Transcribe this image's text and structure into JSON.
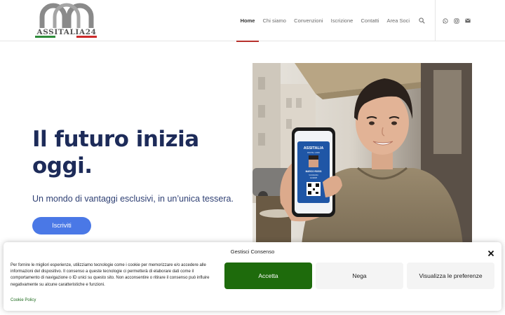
{
  "logo": {
    "text": "ASSITALIA24",
    "flag_colors": [
      "#2e8b3a",
      "#ffffff",
      "#cc2a2a"
    ]
  },
  "nav": {
    "items": [
      {
        "label": "Home",
        "active": true
      },
      {
        "label": "Chi siamo",
        "active": false
      },
      {
        "label": "Convenzioni",
        "active": false
      },
      {
        "label": "Iscrizione",
        "active": false
      },
      {
        "label": "Contatti",
        "active": false
      },
      {
        "label": "Area Soci",
        "active": false
      }
    ],
    "search_icon": "search-icon",
    "social_icons": [
      "whatsapp-icon",
      "instagram-icon",
      "mail-icon"
    ]
  },
  "hero": {
    "title": "Il futuro inizia oggi.",
    "subtitle": "Un mondo di vantaggi esclusivi, in un’unica tessera.",
    "button": "Iscriviti"
  },
  "photo": {
    "phone_card": {
      "brand": "ASSITALIA",
      "card_type": "DIGITAL CARD",
      "name": "MARCO ROSSI",
      "member_label": "SCADENZA",
      "date": "12/2025"
    }
  },
  "colors": {
    "accent": "#b7312c",
    "title": "#1d2b59",
    "button": "#4a78e6",
    "accept": "#1e6b0c"
  },
  "cookie": {
    "title": "Gestisci Consenso",
    "text": "Per fornire le migliori esperienze, utilizziamo tecnologie come i cookie per memorizzare e/o accedere alle informazioni del dispositivo. Il consenso a queste tecnologie ci permetterà di elaborare dati come il comportamento di navigazione o ID unici su questo sito. Non acconsentire o ritirare il consenso può influire negativamente su alcune caratteristiche e funzioni.",
    "policy_link": "Cookie Policy",
    "accept": "Accetta",
    "deny": "Nega",
    "preferences": "Visualizza le preferenze"
  }
}
